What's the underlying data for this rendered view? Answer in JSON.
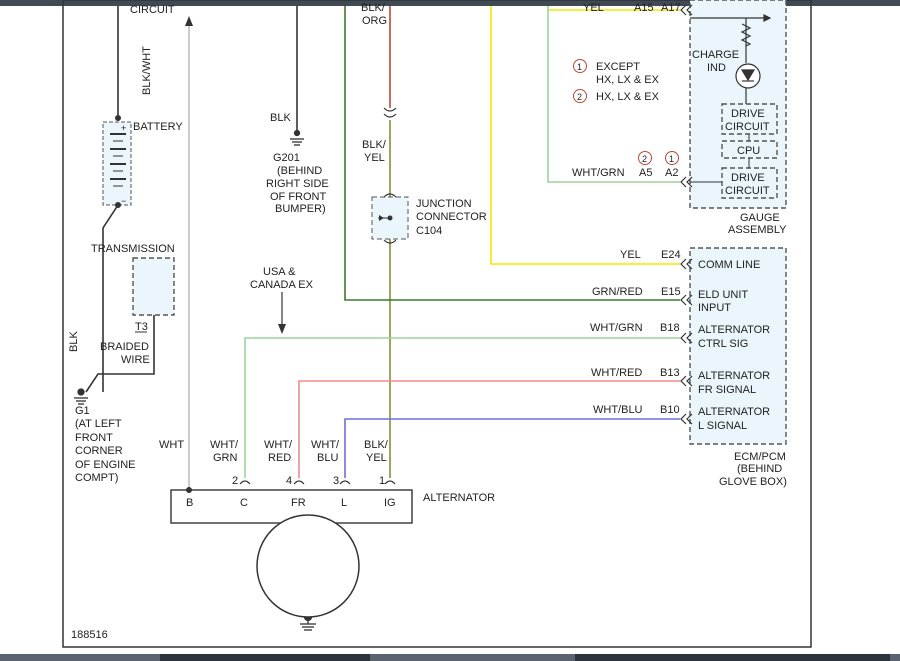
{
  "colors": {
    "yel": "#f5e900",
    "grn_red": "#3d7a2a",
    "wht_grn": "#9cd39c",
    "wht_red": "#f08a8a",
    "wht_blu": "#6e6ee0",
    "blk_org": "#b54b3a",
    "blk_yel": "#8a8a3a",
    "blk": "#333333",
    "wht": "#c0c0c0"
  },
  "labels": {
    "circuit": "CIRCUIT",
    "blk_wht": "BLK/WHT",
    "battery": "BATTERY",
    "blk_g201": "BLK",
    "g201": [
      "G201",
      "(BEHIND",
      "RIGHT SIDE",
      "OF FRONT",
      "BUMPER)"
    ],
    "blk_org": [
      "BLK/",
      "ORG"
    ],
    "blk_yel_mid": [
      "BLK/",
      "YEL"
    ],
    "junction": [
      "JUNCTION",
      "CONNECTOR",
      "C104"
    ],
    "yel_top": "YEL",
    "pin_a15": "A15",
    "pin_a17": "A17",
    "legend1": [
      "EXCEPT",
      "HX, LX & EX"
    ],
    "legend2": "HX, LX & EX",
    "num1": "1",
    "num2": "2",
    "charge_ind": [
      "CHARGE",
      "IND"
    ],
    "drive_circuit": [
      "DRIVE",
      "CIRCUIT"
    ],
    "cpu": "CPU",
    "wht_grn_top": "WHT/GRN",
    "pin_a5": "A5",
    "pin_a2": "A2",
    "gauge_assembly": [
      "GAUGE",
      "ASSEMBLY"
    ],
    "transmission": "TRANSMISSION",
    "t3": "T3",
    "braided_wire": [
      "BRAIDED",
      "WIRE"
    ],
    "blk_left": "BLK",
    "g1": [
      "G1",
      "(AT LEFT",
      "FRONT",
      "CORNER",
      "OF ENGINE",
      "COMPT)"
    ],
    "usa_canada": [
      "USA &",
      "CANADA EX"
    ],
    "yel_e24": "YEL",
    "pin_e24": "E24",
    "comm_line": "COMM LINE",
    "grn_red": "GRN/RED",
    "pin_e15": "E15",
    "eld": [
      "ELD UNIT",
      "INPUT"
    ],
    "wht_grn_b18": "WHT/GRN",
    "pin_b18": "B18",
    "alt_ctrl": [
      "ALTERNATOR",
      "CTRL SIG"
    ],
    "wht_red_b13": "WHT/RED",
    "pin_b13": "B13",
    "alt_fr": [
      "ALTERNATOR",
      "FR SIGNAL"
    ],
    "wht_blu_b10": "WHT/BLU",
    "pin_b10": "B10",
    "alt_l": [
      "ALTERNATOR",
      "L SIGNAL"
    ],
    "ecm": [
      "ECM/PCM",
      "(BEHIND",
      "GLOVE BOX)"
    ],
    "wht": "WHT",
    "wire_c": [
      "WHT/",
      "GRN"
    ],
    "wire_fr": [
      "WHT/",
      "RED"
    ],
    "wire_l": [
      "WHT/",
      "BLU"
    ],
    "wire_ig": [
      "BLK/",
      "YEL"
    ],
    "pin2": "2",
    "pin4": "4",
    "pin3": "3",
    "pin1": "1",
    "term_b": "B",
    "term_c": "C",
    "term_fr": "FR",
    "term_l": "L",
    "term_ig": "IG",
    "alternator": "ALTERNATOR",
    "figure_id": "188516"
  }
}
